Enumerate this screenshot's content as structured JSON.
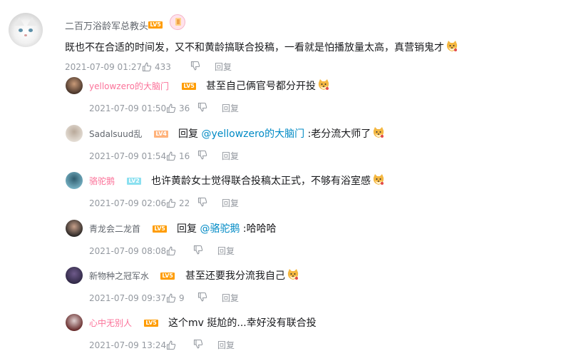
{
  "main_comment": {
    "username": "二百万浴龄军总教头",
    "level": "LV5",
    "badge_icon": "medal-badge-icon",
    "text": "既也不在合适的时间发，又不和黄龄搞联合投稿，一看就是怕播放量太高，真营销鬼才",
    "time": "2021-07-09 01:27",
    "likes": "433",
    "reply_label": "回复"
  },
  "replies": [
    {
      "username": "yellowzero的大脑门",
      "name_color": "pink",
      "level": "LV5",
      "prefix": "",
      "mention": "",
      "text": "甚至自己俩官号都分开投",
      "emoji": true,
      "time": "2021-07-09 01:50",
      "likes": "36",
      "reply_label": "回复"
    },
    {
      "username": "Sadalsuud乱",
      "name_color": "gray",
      "level": "LV4",
      "prefix": "回复 ",
      "mention": "@yellowzero的大脑门",
      "text": " :老分流大师了",
      "emoji": true,
      "time": "2021-07-09 01:54",
      "likes": "16",
      "reply_label": "回复"
    },
    {
      "username": "骆驼鹅",
      "name_color": "pink",
      "level": "LV2",
      "prefix": "",
      "mention": "",
      "text": "也许黄龄女士觉得联合投稿太正式，不够有浴室感",
      "emoji": true,
      "time": "2021-07-09 02:06",
      "likes": "22",
      "reply_label": "回复"
    },
    {
      "username": "青龙会二龙首",
      "name_color": "gray",
      "level": "LV5",
      "prefix": "回复 ",
      "mention": "@骆驼鹅",
      "text": " :哈哈哈",
      "emoji": false,
      "time": "2021-07-09 08:08",
      "likes": "",
      "reply_label": "回复"
    },
    {
      "username": "新物种之冠军水",
      "name_color": "gray",
      "level": "LV5",
      "prefix": "",
      "mention": "",
      "text": "甚至还要我分流我自己",
      "emoji": true,
      "time": "2021-07-09 09:37",
      "likes": "9",
      "reply_label": "回复"
    },
    {
      "username": "心中无别人",
      "name_color": "pink",
      "level": "LV5",
      "prefix": "",
      "mention": "",
      "text": "这个mv 挺尬的...幸好没有联合投",
      "emoji": false,
      "time": "2021-07-09 13:24",
      "likes": "",
      "reply_label": "回复"
    }
  ],
  "icons": {
    "like": "thumbs-up-icon",
    "dislike": "thumbs-down-icon",
    "emoji": "doge-emoji-icon"
  },
  "colors": {
    "pink_name": "#fb7299",
    "mention_blue": "#008ac5",
    "meta_gray": "#9499a0",
    "level5": "#ff9c00"
  }
}
